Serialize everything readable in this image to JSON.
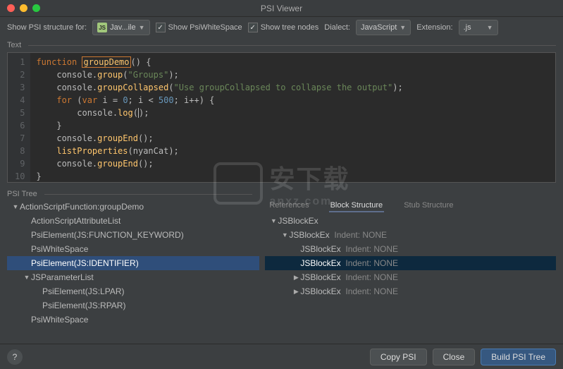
{
  "window": {
    "title": "PSI Viewer"
  },
  "toolbar": {
    "structure_label": "Show PSI structure for:",
    "file_dropdown": "Jav...ile",
    "chk_whitespace": "Show PsiWhiteSpace",
    "chk_treenodes": "Show tree nodes",
    "dialect_label": "Dialect:",
    "dialect_value": "JavaScript",
    "extension_label": "Extension:",
    "extension_value": ".js"
  },
  "sections": {
    "text": "Text",
    "psitree": "PSI Tree"
  },
  "code": {
    "lines": [
      {
        "n": "1",
        "pre": "",
        "kw": "function ",
        "id": "groupDemo",
        "rest": "() {"
      },
      {
        "n": "2",
        "pre": "    ",
        "plain": "console.",
        "fn": "group",
        "args": "(",
        "str": "\"Groups\"",
        "close": ");"
      },
      {
        "n": "3",
        "pre": "    ",
        "plain": "console.",
        "fn": "groupCollapsed",
        "args": "(",
        "str": "\"Use groupCollapsed to collapse the output\"",
        "close": ");"
      },
      {
        "n": "4",
        "pre": "    ",
        "kw": "for ",
        "plain": "(",
        "kw2": "var ",
        "plain2": "i = ",
        "num": "0",
        "plain3": "; i < ",
        "num2": "500",
        "plain4": "; i++) {"
      },
      {
        "n": "5",
        "pre": "        ",
        "plain": "console.",
        "fn": "log",
        "args": "(",
        "caret": true,
        "close": ");"
      },
      {
        "n": "6",
        "pre": "    ",
        "plain": "}"
      },
      {
        "n": "7",
        "pre": "    ",
        "plain": "console.",
        "fn": "groupEnd",
        "args": "()",
        "close": ";"
      },
      {
        "n": "8",
        "pre": "    ",
        "fn": "listProperties",
        "args": "(nyanCat)",
        "close": ";"
      },
      {
        "n": "9",
        "pre": "    ",
        "plain": "console.",
        "fn": "groupEnd",
        "args": "()",
        "close": ";"
      },
      {
        "n": "10",
        "pre": "",
        "plain": "}"
      }
    ]
  },
  "tabs": {
    "references": "References",
    "block": "Block Structure",
    "stub": "Stub Structure"
  },
  "psitree": [
    {
      "depth": 0,
      "arrow": "down",
      "text": "ActionScriptFunction:groupDemo"
    },
    {
      "depth": 1,
      "arrow": "",
      "text": "ActionScriptAttributeList"
    },
    {
      "depth": 1,
      "arrow": "",
      "text": "PsiElement(JS:FUNCTION_KEYWORD)"
    },
    {
      "depth": 1,
      "arrow": "",
      "text": "PsiWhiteSpace"
    },
    {
      "depth": 1,
      "arrow": "",
      "text": "PsiElement(JS:IDENTIFIER)",
      "sel": true
    },
    {
      "depth": 1,
      "arrow": "down",
      "text": "JSParameterList"
    },
    {
      "depth": 2,
      "arrow": "",
      "text": "PsiElement(JS:LPAR)"
    },
    {
      "depth": 2,
      "arrow": "",
      "text": "PsiElement(JS:RPAR)"
    },
    {
      "depth": 1,
      "arrow": "",
      "text": "PsiWhiteSpace"
    }
  ],
  "blocktree": [
    {
      "depth": 0,
      "arrow": "down",
      "text": "JSBlockEx",
      "suffix": ""
    },
    {
      "depth": 1,
      "arrow": "down",
      "text": "JSBlockEx",
      "suffix": "Indent: NONE"
    },
    {
      "depth": 2,
      "arrow": "",
      "text": "JSBlockEx",
      "suffix": "Indent: NONE"
    },
    {
      "depth": 2,
      "arrow": "",
      "text": "JSBlockEx",
      "suffix": "Indent: NONE",
      "sel": true
    },
    {
      "depth": 2,
      "arrow": "right",
      "text": "JSBlockEx",
      "suffix": "Indent: NONE"
    },
    {
      "depth": 2,
      "arrow": "right",
      "text": "JSBlockEx",
      "suffix": "Indent: NONE"
    }
  ],
  "footer": {
    "copy": "Copy PSI",
    "close": "Close",
    "build": "Build PSI Tree"
  },
  "watermark": {
    "text": "安下载",
    "sub": "anxz.com"
  }
}
